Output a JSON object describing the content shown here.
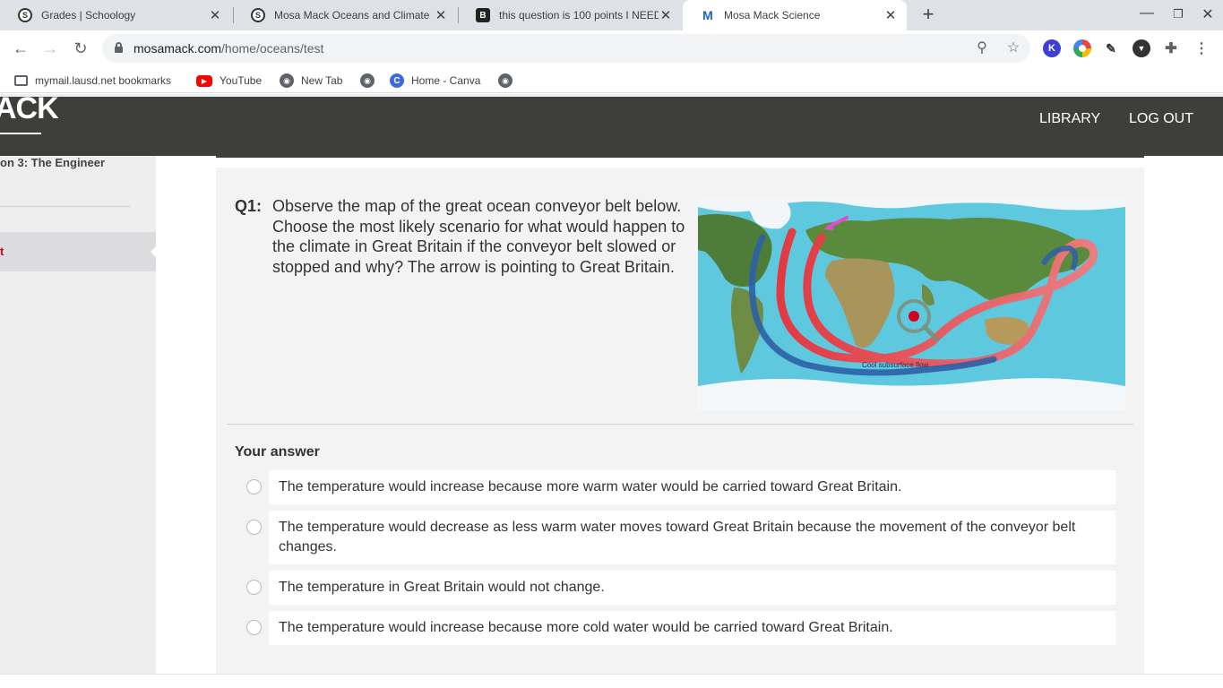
{
  "browser": {
    "tabs": [
      {
        "title": "Grades | Schoology",
        "icon": "S"
      },
      {
        "title": "Mosa Mack Oceans and Climate",
        "icon": "S"
      },
      {
        "title": "this question is 100 points I NEED",
        "icon": "B"
      },
      {
        "title": "Mosa Mack Science",
        "icon": "M"
      }
    ],
    "url_host": "mosamack.com",
    "url_path": "/home/oceans/test",
    "bookmarks": [
      {
        "label": "mymail.lausd.net bookmarks"
      },
      {
        "label": "YouTube"
      },
      {
        "label": "New Tab"
      },
      {
        "label": ""
      },
      {
        "label": "Home - Canva"
      },
      {
        "label": ""
      }
    ],
    "extensions": [
      {
        "letter": "K",
        "color": "#3d3fd6"
      },
      {
        "letter": "",
        "color": "#e8453c"
      }
    ]
  },
  "site": {
    "logo": "ACK",
    "nav": {
      "library": "LIBRARY",
      "logout": "LOG OUT"
    }
  },
  "sidebar": {
    "lesson": "on 3: The Engineer",
    "active_item": "t"
  },
  "question": {
    "label": "Q1:",
    "text": "Observe the map of the great ocean conveyor belt below. Choose the most likely scenario for what would happen to the climate in Great Britain if the conveyor belt slowed or stopped and why? The arrow is pointing to Great Britain.",
    "map_caption": "Cool subsurface flow"
  },
  "answers": {
    "heading": "Your answer",
    "options": [
      "The temperature would increase because more warm water would be carried toward Great Britain.",
      "The temperature would decrease as less warm water moves toward Great Britain because the movement of the conveyor belt changes.",
      "The temperature in Great Britain would not change.",
      "The temperature would increase because more cold water would be carried toward Great Britain."
    ]
  },
  "colors": {
    "header_bg": "#3e3f3b",
    "accent_red": "#d0021b",
    "ocean": "#5ec8df"
  }
}
